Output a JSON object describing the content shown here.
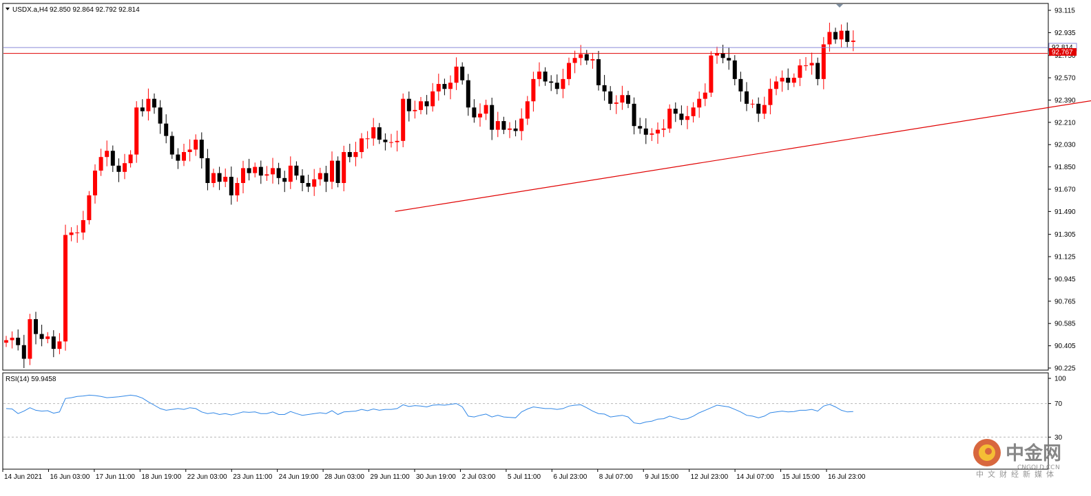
{
  "chart_data": {
    "type": "candlestick",
    "symbol_header": "USDX.a,H4",
    "ohlc_header": "92.850 92.864 92.792 92.814",
    "price_axis_ticks": [
      "93.115",
      "92.935",
      "92.750",
      "92.570",
      "92.390",
      "92.210",
      "92.030",
      "91.850",
      "91.670",
      "91.490",
      "91.305",
      "91.125",
      "90.945",
      "90.765",
      "90.585",
      "90.405",
      "90.225"
    ],
    "price_range": [
      90.225,
      93.115
    ],
    "time_labels": [
      "14 Jun 2021",
      "16 Jun 03:00",
      "17 Jun 11:00",
      "18 Jun 19:00",
      "22 Jun 03:00",
      "23 Jun 11:00",
      "24 Jun 19:00",
      "28 Jun 03:00",
      "29 Jun 11:00",
      "30 Jun 19:00",
      "2 Jul 03:00",
      "5 Jul 11:00",
      "6 Jul 23:00",
      "8 Jul 07:00",
      "9 Jul 15:00",
      "12 Jul 23:00",
      "14 Jul 07:00",
      "15 Jul 15:00",
      "16 Jul 23:00"
    ],
    "current_price_label": "92.814",
    "resistance_label": "92.767",
    "resistance_level": 92.767,
    "support_trendline": {
      "start": {
        "bar": 66,
        "price": 91.49
      },
      "end": {
        "bar": 200,
        "price": 92.51
      }
    },
    "colors": {
      "up": "#ff0000",
      "down": "#000000",
      "resistance": "#e00000",
      "trendline": "#e00000",
      "current": "#8a8ad8",
      "rsi": "#2f86e6"
    },
    "candles_close": [
      90.45,
      90.47,
      90.41,
      90.3,
      90.62,
      90.5,
      90.46,
      90.48,
      90.38,
      90.44,
      91.3,
      91.32,
      91.32,
      91.42,
      91.62,
      91.82,
      91.93,
      91.98,
      91.86,
      91.81,
      91.88,
      91.95,
      92.33,
      92.3,
      92.4,
      92.33,
      92.2,
      92.1,
      91.95,
      91.9,
      91.97,
      91.99,
      92.07,
      91.92,
      91.72,
      91.8,
      91.73,
      91.77,
      91.62,
      91.72,
      91.84,
      91.8,
      91.85,
      91.78,
      91.79,
      91.84,
      91.76,
      91.73,
      91.86,
      91.78,
      91.72,
      91.69,
      91.75,
      91.8,
      91.73,
      91.9,
      91.72,
      91.97,
      91.93,
      91.97,
      92.08,
      92.08,
      92.17,
      92.07,
      92.05,
      92.05,
      92.06,
      92.4,
      92.3,
      92.31,
      92.38,
      92.34,
      92.46,
      92.52,
      92.48,
      92.53,
      92.66,
      92.55,
      92.33,
      92.25,
      92.28,
      92.35,
      92.15,
      92.22,
      92.15,
      92.16,
      92.14,
      92.24,
      92.38,
      92.56,
      92.62,
      92.54,
      92.53,
      92.48,
      92.56,
      92.69,
      92.73,
      92.76,
      92.71,
      92.72,
      92.51,
      92.46,
      92.36,
      92.37,
      92.43,
      92.36,
      92.18,
      92.16,
      92.11,
      92.12,
      92.15,
      92.16,
      92.32,
      92.28,
      92.23,
      92.26,
      92.33,
      92.4,
      92.45,
      92.75,
      92.77,
      92.73,
      92.71,
      92.56,
      92.46,
      92.36,
      92.36,
      92.28,
      92.35,
      92.48,
      92.54,
      92.57,
      92.53,
      92.57,
      92.67,
      92.67,
      92.69,
      92.56,
      92.84,
      92.94,
      92.88,
      92.95,
      92.86,
      92.87
    ],
    "rsi_label": "RSI(14) 59.9458",
    "rsi_axis_ticks": [
      "100",
      "70",
      "30"
    ],
    "rsi_levels": [
      30,
      70
    ],
    "rsi_range": [
      0,
      100
    ],
    "rsi_values": [
      64.0,
      63.5,
      58.0,
      61.0,
      65.0,
      62.0,
      61.0,
      61.5,
      58.5,
      60.0,
      76.0,
      77.0,
      78.5,
      79.0,
      80.0,
      79.5,
      78.5,
      77.0,
      77.5,
      78.0,
      79.0,
      80.0,
      79.0,
      76.5,
      72.0,
      68.0,
      64.0,
      62.0,
      63.0,
      64.0,
      63.0,
      65.0,
      64.0,
      60.0,
      58.0,
      59.0,
      57.0,
      58.0,
      56.5,
      58.0,
      60.0,
      59.5,
      60.0,
      58.0,
      58.0,
      60.0,
      57.0,
      57.0,
      60.5,
      58.0,
      56.0,
      57.0,
      58.0,
      59.0,
      58.0,
      61.5,
      57.0,
      60.0,
      60.5,
      61.0,
      63.0,
      61.5,
      63.5,
      62.0,
      63.0,
      63.0,
      64.0,
      68.5,
      66.5,
      67.5,
      67.0,
      66.0,
      68.0,
      68.5,
      68.0,
      69.0,
      70.0,
      66.0,
      55.0,
      54.0,
      56.0,
      57.5,
      54.0,
      56.0,
      54.0,
      53.5,
      53.0,
      60.0,
      63.5,
      66.0,
      65.0,
      64.0,
      64.0,
      63.0,
      64.0,
      67.0,
      68.0,
      68.5,
      65.0,
      61.0,
      58.0,
      57.5,
      54.0,
      55.0,
      56.0,
      54.0,
      47.0,
      46.0,
      48.0,
      49.0,
      51.5,
      52.0,
      55.0,
      53.0,
      51.0,
      52.0,
      55.0,
      59.0,
      62.0,
      65.0,
      68.0,
      67.0,
      66.0,
      63.0,
      60.0,
      56.0,
      55.0,
      53.0,
      55.0,
      59.0,
      60.0,
      61.0,
      60.0,
      60.5,
      62.0,
      62.0,
      63.0,
      61.0,
      67.0,
      69.0,
      66.0,
      62.0,
      60.0,
      60.5
    ]
  },
  "watermark": {
    "main": "中金网",
    "sub": "CNGOLD.CC",
    "sub_suffix": "N",
    "tagline": "中文财经新媒体"
  }
}
